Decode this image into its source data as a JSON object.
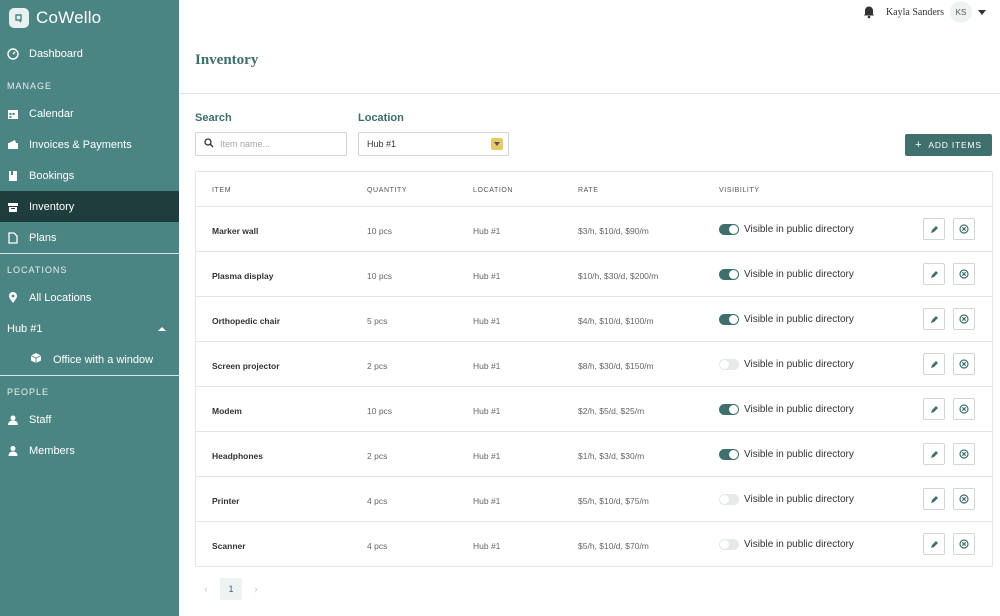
{
  "brand": {
    "name": "CoWello"
  },
  "sidebar": {
    "dashboard": "Dashboard",
    "manage_title": "MANAGE",
    "manage_items": [
      {
        "label": "Calendar",
        "icon": "calendar-icon"
      },
      {
        "label": "Invoices & Payments",
        "icon": "wallet-icon"
      },
      {
        "label": "Bookings",
        "icon": "bookings-icon"
      },
      {
        "label": "Inventory",
        "icon": "inventory-icon",
        "active": true
      },
      {
        "label": "Plans",
        "icon": "plans-icon"
      }
    ],
    "locations_title": "LOCATIONS",
    "all_locations": "All Locations",
    "hub": "Hub #1",
    "hub_sub": "Office with a window",
    "people_title": "PEOPLE",
    "staff": "Staff",
    "members": "Members"
  },
  "user": {
    "name": "Kayla Sanders",
    "initials": "KS"
  },
  "page": {
    "title": "Inventory"
  },
  "filters": {
    "search_label": "Search",
    "search_placeholder": "Item name...",
    "location_label": "Location",
    "location_value": "Hub #1"
  },
  "actions": {
    "add_items": "ADD ITEMS"
  },
  "table": {
    "headers": {
      "item": "ITEM",
      "quantity": "QUANTITY",
      "location": "LOCATION",
      "rate": "RATE",
      "visibility": "VISIBILITY"
    },
    "visibility_label": "Visible in public directory",
    "rows": [
      {
        "item": "Marker wall",
        "quantity": "10 pcs",
        "location": "Hub #1",
        "rate": "$3/h, $10/d, $90/m",
        "visible": true
      },
      {
        "item": "Plasma display",
        "quantity": "10 pcs",
        "location": "Hub #1",
        "rate": "$10/h, $30/d, $200/m",
        "visible": true
      },
      {
        "item": "Orthopedic chair",
        "quantity": "5 pcs",
        "location": "Hub #1",
        "rate": "$4/h, $10/d, $100/m",
        "visible": true
      },
      {
        "item": "Screen projector",
        "quantity": "2 pcs",
        "location": "Hub #1",
        "rate": "$8/h, $30/d, $150/m",
        "visible": false
      },
      {
        "item": "Modem",
        "quantity": "10 pcs",
        "location": "Hub #1",
        "rate": "$2/h, $5/d, $25/m",
        "visible": true
      },
      {
        "item": "Headphones",
        "quantity": "2 pcs",
        "location": "Hub #1",
        "rate": "$1/h, $3/d, $30/m",
        "visible": true
      },
      {
        "item": "Printer",
        "quantity": "4 pcs",
        "location": "Hub #1",
        "rate": "$5/h, $10/d, $75/m",
        "visible": false
      },
      {
        "item": "Scanner",
        "quantity": "4 pcs",
        "location": "Hub #1",
        "rate": "$5/h, $10/d, $70/m",
        "visible": false
      }
    ]
  },
  "pagination": {
    "current": "1",
    "prev": "‹",
    "next": "›"
  },
  "colors": {
    "sidebar": "#4b8583",
    "active": "#1f3d3c",
    "accent": "#3f706e",
    "select_button": "#e8c96a"
  }
}
